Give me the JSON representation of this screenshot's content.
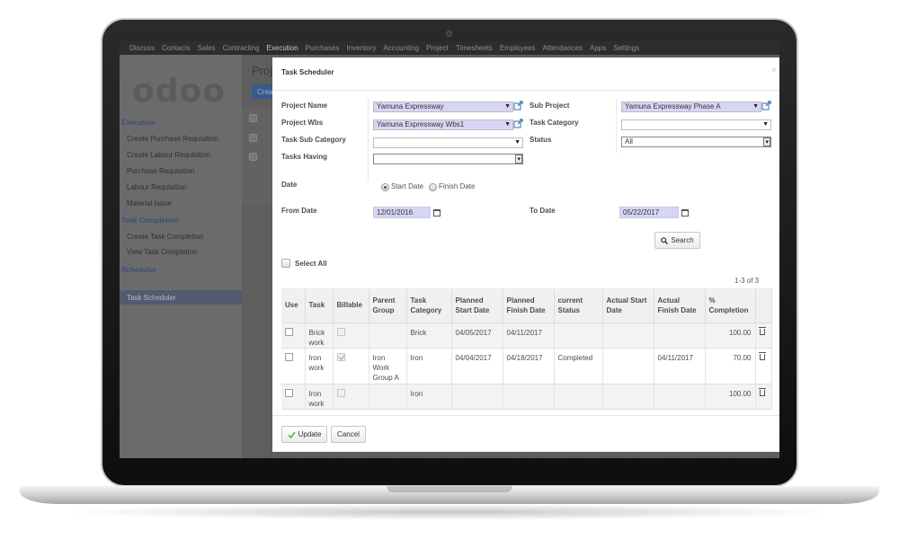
{
  "topmenu": [
    "Discuss",
    "Contacts",
    "Sales",
    "Contracting",
    "Execution",
    "Purchases",
    "Inventory",
    "Accounting",
    "Project",
    "Timesheets",
    "Employees",
    "Attendances",
    "Apps",
    "Settings"
  ],
  "logo": {
    "text": "odoo"
  },
  "sidebar": {
    "sections": [
      {
        "title": "Execution",
        "items": [
          "Create Purchase Requisition",
          "Create Labour Requisition",
          "Purchase Requisition",
          "Labour Requisition",
          "Material Issue"
        ]
      },
      {
        "title": "Task Completion",
        "items": [
          "Create Task Completion",
          "View Task Completion"
        ]
      },
      {
        "title": "Scheduler",
        "items": [
          "Task Scheduler"
        ]
      }
    ],
    "selected": "Task Scheduler"
  },
  "background": {
    "page_title": "Proje",
    "create_button": "Crea"
  },
  "modal": {
    "title": "Task Scheduler",
    "close": "×",
    "fields": {
      "project_name": {
        "label": "Project Name",
        "value": "Yamuna Expressway"
      },
      "sub_project": {
        "label": "Sub Project",
        "value": "Yamuna Expressway Phase A"
      },
      "project_wbs": {
        "label": "Project Wbs",
        "value": "Yamuna Expressway Wbs1"
      },
      "task_category": {
        "label": "Task Category",
        "value": ""
      },
      "task_sub_category": {
        "label": "Task Sub Category",
        "value": ""
      },
      "status": {
        "label": "Status",
        "value": "All"
      },
      "tasks_having": {
        "label": "Tasks Having",
        "value": ""
      },
      "date": {
        "label": "Date",
        "options": [
          "Start Date",
          "Finish Date"
        ],
        "selected": "Start Date"
      },
      "from_date": {
        "label": "From Date",
        "value": "12/01/2016"
      },
      "to_date": {
        "label": "To Date",
        "value": "05/22/2017"
      }
    },
    "search_button": "Search",
    "select_all": "Select All",
    "pager": "1-3 of 3",
    "table": {
      "headers": [
        "Use",
        "Task",
        "Billable",
        "Parent Group",
        "Task Category",
        "Planned Start Date",
        "Planned Finish Date",
        "current Status",
        "Actual Start Date",
        "Actual Finish Date",
        "% Completion"
      ],
      "rows": [
        {
          "task": "Brick work",
          "billable": false,
          "parent_group": "",
          "task_category": "Brick",
          "planned_start": "04/05/2017",
          "planned_finish": "04/11/2017",
          "current_status": "",
          "actual_start": "",
          "actual_finish": "",
          "completion": "100.00"
        },
        {
          "task": "Iron work",
          "billable": true,
          "parent_group": "Iron Work Group A",
          "task_category": "Iron",
          "planned_start": "04/04/2017",
          "planned_finish": "04/18/2017",
          "current_status": "Completed",
          "actual_start": "",
          "actual_finish": "04/11/2017",
          "completion": "70.00"
        },
        {
          "task": "Iron work",
          "billable": false,
          "parent_group": "",
          "task_category": "Iron",
          "planned_start": "",
          "planned_finish": "",
          "current_status": "",
          "actual_start": "",
          "actual_finish": "",
          "completion": "100.00"
        }
      ]
    },
    "update_button": "Update",
    "cancel_button": "Cancel"
  },
  "colors": {
    "required_field": "#d6d6f4",
    "update_check": "#5cb85c",
    "logo_o": "#7a3d58",
    "section_title": "#3b4e78"
  }
}
